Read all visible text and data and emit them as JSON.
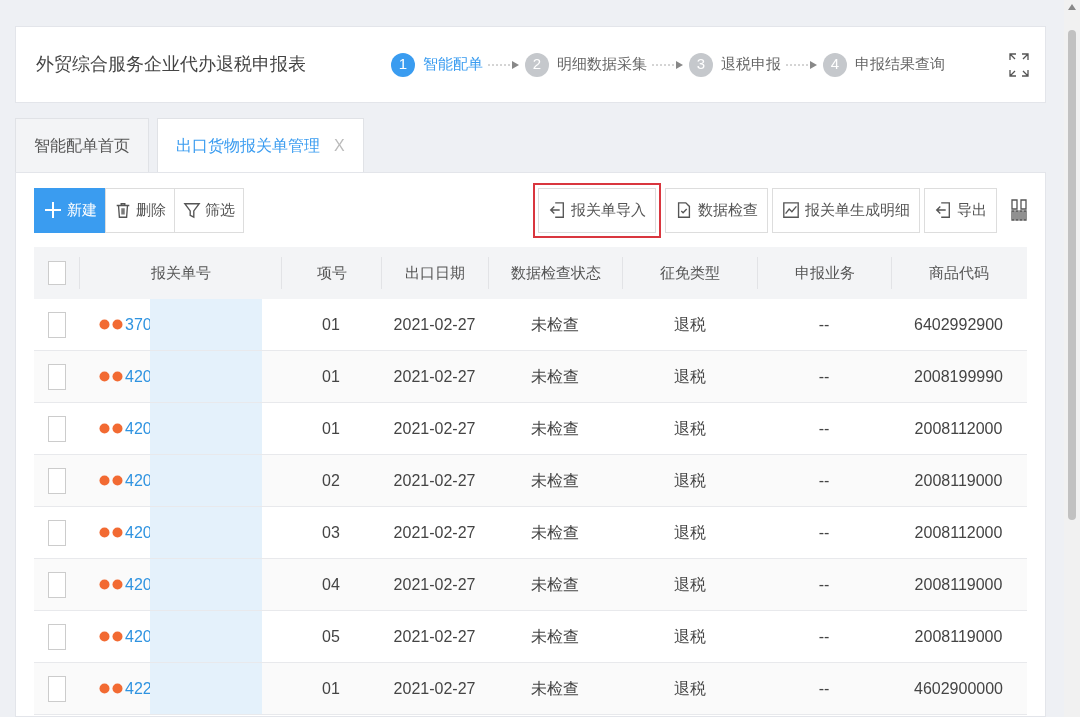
{
  "header": {
    "title": "外贸综合服务企业代办退税申报表",
    "steps": [
      {
        "number": "1",
        "label": "智能配单",
        "selected": true
      },
      {
        "number": "2",
        "label": "明细数据采集",
        "selected": false
      },
      {
        "number": "3",
        "label": "退税申报",
        "selected": false
      },
      {
        "number": "4",
        "label": "申报结果查询",
        "selected": false
      }
    ]
  },
  "tabs": [
    {
      "label": "智能配单首页",
      "selected": false
    },
    {
      "label": "出口货物报关单管理",
      "selected": true,
      "close": "X"
    }
  ],
  "toolbar_left": [
    {
      "kind": "primary",
      "label": "新建"
    },
    {
      "kind": "plain",
      "label": "删除"
    },
    {
      "kind": "plain",
      "label": "筛选"
    }
  ],
  "toolbar_right": [
    {
      "label": "报关单导入",
      "highlighted": true
    },
    {
      "label": "数据检查",
      "highlighted": false
    },
    {
      "label": "报关单生成明细",
      "highlighted": false
    },
    {
      "label": "导出",
      "highlighted": false
    }
  ],
  "table": {
    "header_checked": false,
    "columns": [
      "报关单号",
      "项号",
      "出口日期",
      "数据检查状态",
      "征免类型",
      "申报业务",
      "商品代码"
    ],
    "rows": [
      {
        "checked": false,
        "number": "370",
        "item": "01",
        "date": "2021-02-27",
        "check_status": "未检查",
        "exemption": "退税",
        "business": "--",
        "code": "6402992900"
      },
      {
        "checked": false,
        "number": "420",
        "item": "01",
        "date": "2021-02-27",
        "check_status": "未检查",
        "exemption": "退税",
        "business": "--",
        "code": "2008199990"
      },
      {
        "checked": false,
        "number": "420",
        "item": "01",
        "date": "2021-02-27",
        "check_status": "未检查",
        "exemption": "退税",
        "business": "--",
        "code": "2008112000"
      },
      {
        "checked": false,
        "number": "420",
        "item": "02",
        "date": "2021-02-27",
        "check_status": "未检查",
        "exemption": "退税",
        "business": "--",
        "code": "2008119000"
      },
      {
        "checked": false,
        "number": "420",
        "item": "03",
        "date": "2021-02-27",
        "check_status": "未检查",
        "exemption": "退税",
        "business": "--",
        "code": "2008112000"
      },
      {
        "checked": false,
        "number": "420",
        "item": "04",
        "date": "2021-02-27",
        "check_status": "未检查",
        "exemption": "退税",
        "business": "--",
        "code": "2008119000"
      },
      {
        "checked": false,
        "number": "420",
        "item": "05",
        "date": "2021-02-27",
        "check_status": "未检查",
        "exemption": "退税",
        "business": "--",
        "code": "2008119000"
      },
      {
        "checked": false,
        "number": "422",
        "item": "01",
        "date": "2021-02-27",
        "check_status": "未检查",
        "exemption": "退税",
        "business": "--",
        "code": "4602900000"
      }
    ]
  }
}
